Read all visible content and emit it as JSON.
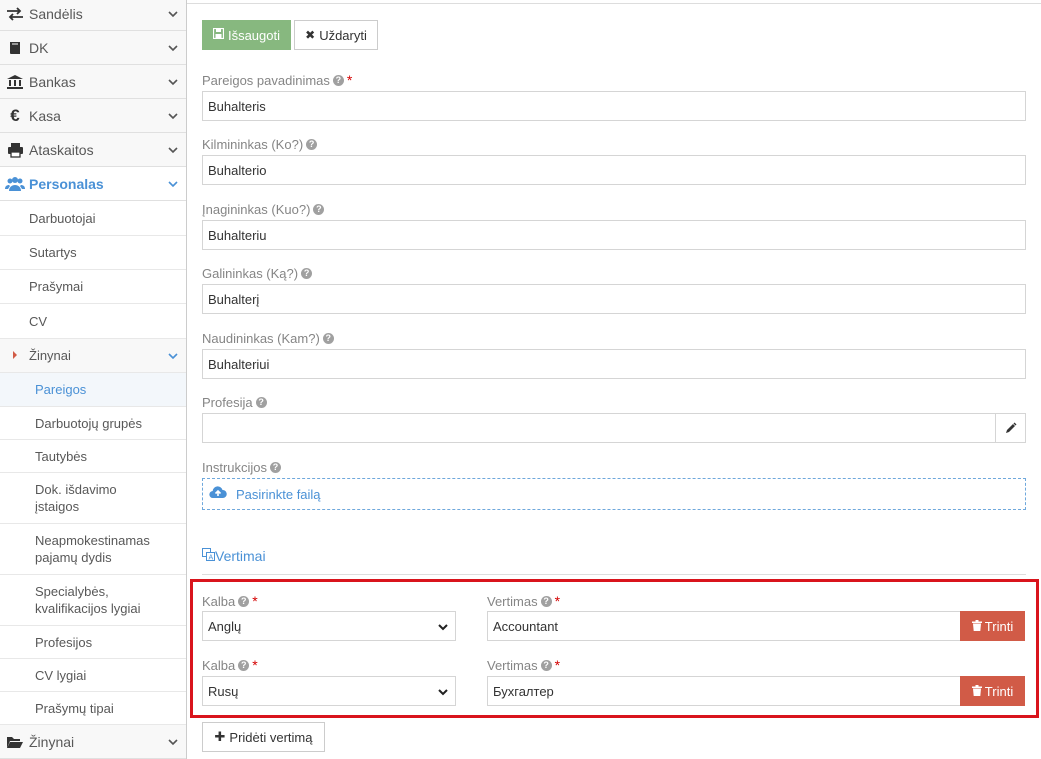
{
  "sidebar": {
    "items": [
      {
        "label": "Sandėlis",
        "icon": "transfer-icon"
      },
      {
        "label": "DK",
        "icon": "book-icon"
      },
      {
        "label": "Bankas",
        "icon": "bank-icon"
      },
      {
        "label": "Kasa",
        "icon": "euro-icon"
      },
      {
        "label": "Ataskaitos",
        "icon": "printer-icon"
      },
      {
        "label": "Personalas",
        "icon": "users-icon"
      }
    ],
    "personalas_sub": [
      "Darbuotojai",
      "Sutartys",
      "Prašymai",
      "CV",
      "Žinynai"
    ],
    "zinynai_sub": [
      {
        "label": "Pareigos"
      },
      {
        "label": "Darbuotojų grupės"
      },
      {
        "label": "Tautybės"
      },
      {
        "label_l1": "Dok. išdavimo",
        "label_l2": "įstaigos"
      },
      {
        "label_l1": "Neapmokestinamas",
        "label_l2": "pajamų dydis"
      },
      {
        "label_l1": "Specialybės,",
        "label_l2": "kvalifikacijos lygiai"
      },
      {
        "label": "Profesijos"
      },
      {
        "label": "CV lygiai"
      },
      {
        "label": "Prašymų tipai"
      }
    ],
    "bottom_item": {
      "label": "Žinynai",
      "icon": "folder-open-icon"
    }
  },
  "toolbar": {
    "save_label": "Išsaugoti",
    "close_label": "Uždaryti"
  },
  "form": {
    "pareigos_label": "Pareigos pavadinimas",
    "pareigos_value": "Buhalteris",
    "kilmininkas_label": "Kilmininkas (Ko?)",
    "kilmininkas_value": "Buhalterio",
    "inagininkas_label": "Įnagininkas (Kuo?)",
    "inagininkas_value": "Buhalteriu",
    "galininkas_label": "Galininkas (Ką?)",
    "galininkas_value": "Buhalterį",
    "naudininkas_label": "Naudininkas (Kam?)",
    "naudininkas_value": "Buhalteriui",
    "profesija_label": "Profesija",
    "profesija_value": "",
    "instrukcijos_label": "Instrukcijos",
    "file_label": "Pasirinkte failą"
  },
  "translations": {
    "section_title": "Vertimai",
    "kalba_label": "Kalba",
    "vertimas_label": "Vertimas",
    "delete_label": "Trinti",
    "rows": [
      {
        "language": "Anglų",
        "text": "Accountant"
      },
      {
        "language": "Rusų",
        "text": "Бухгалтер"
      }
    ],
    "add_label": "Pridėti vertimą"
  },
  "colors": {
    "accent": "#4a91d6",
    "save": "#87b87f",
    "danger": "#d15b47",
    "highlight": "#d9141c"
  }
}
